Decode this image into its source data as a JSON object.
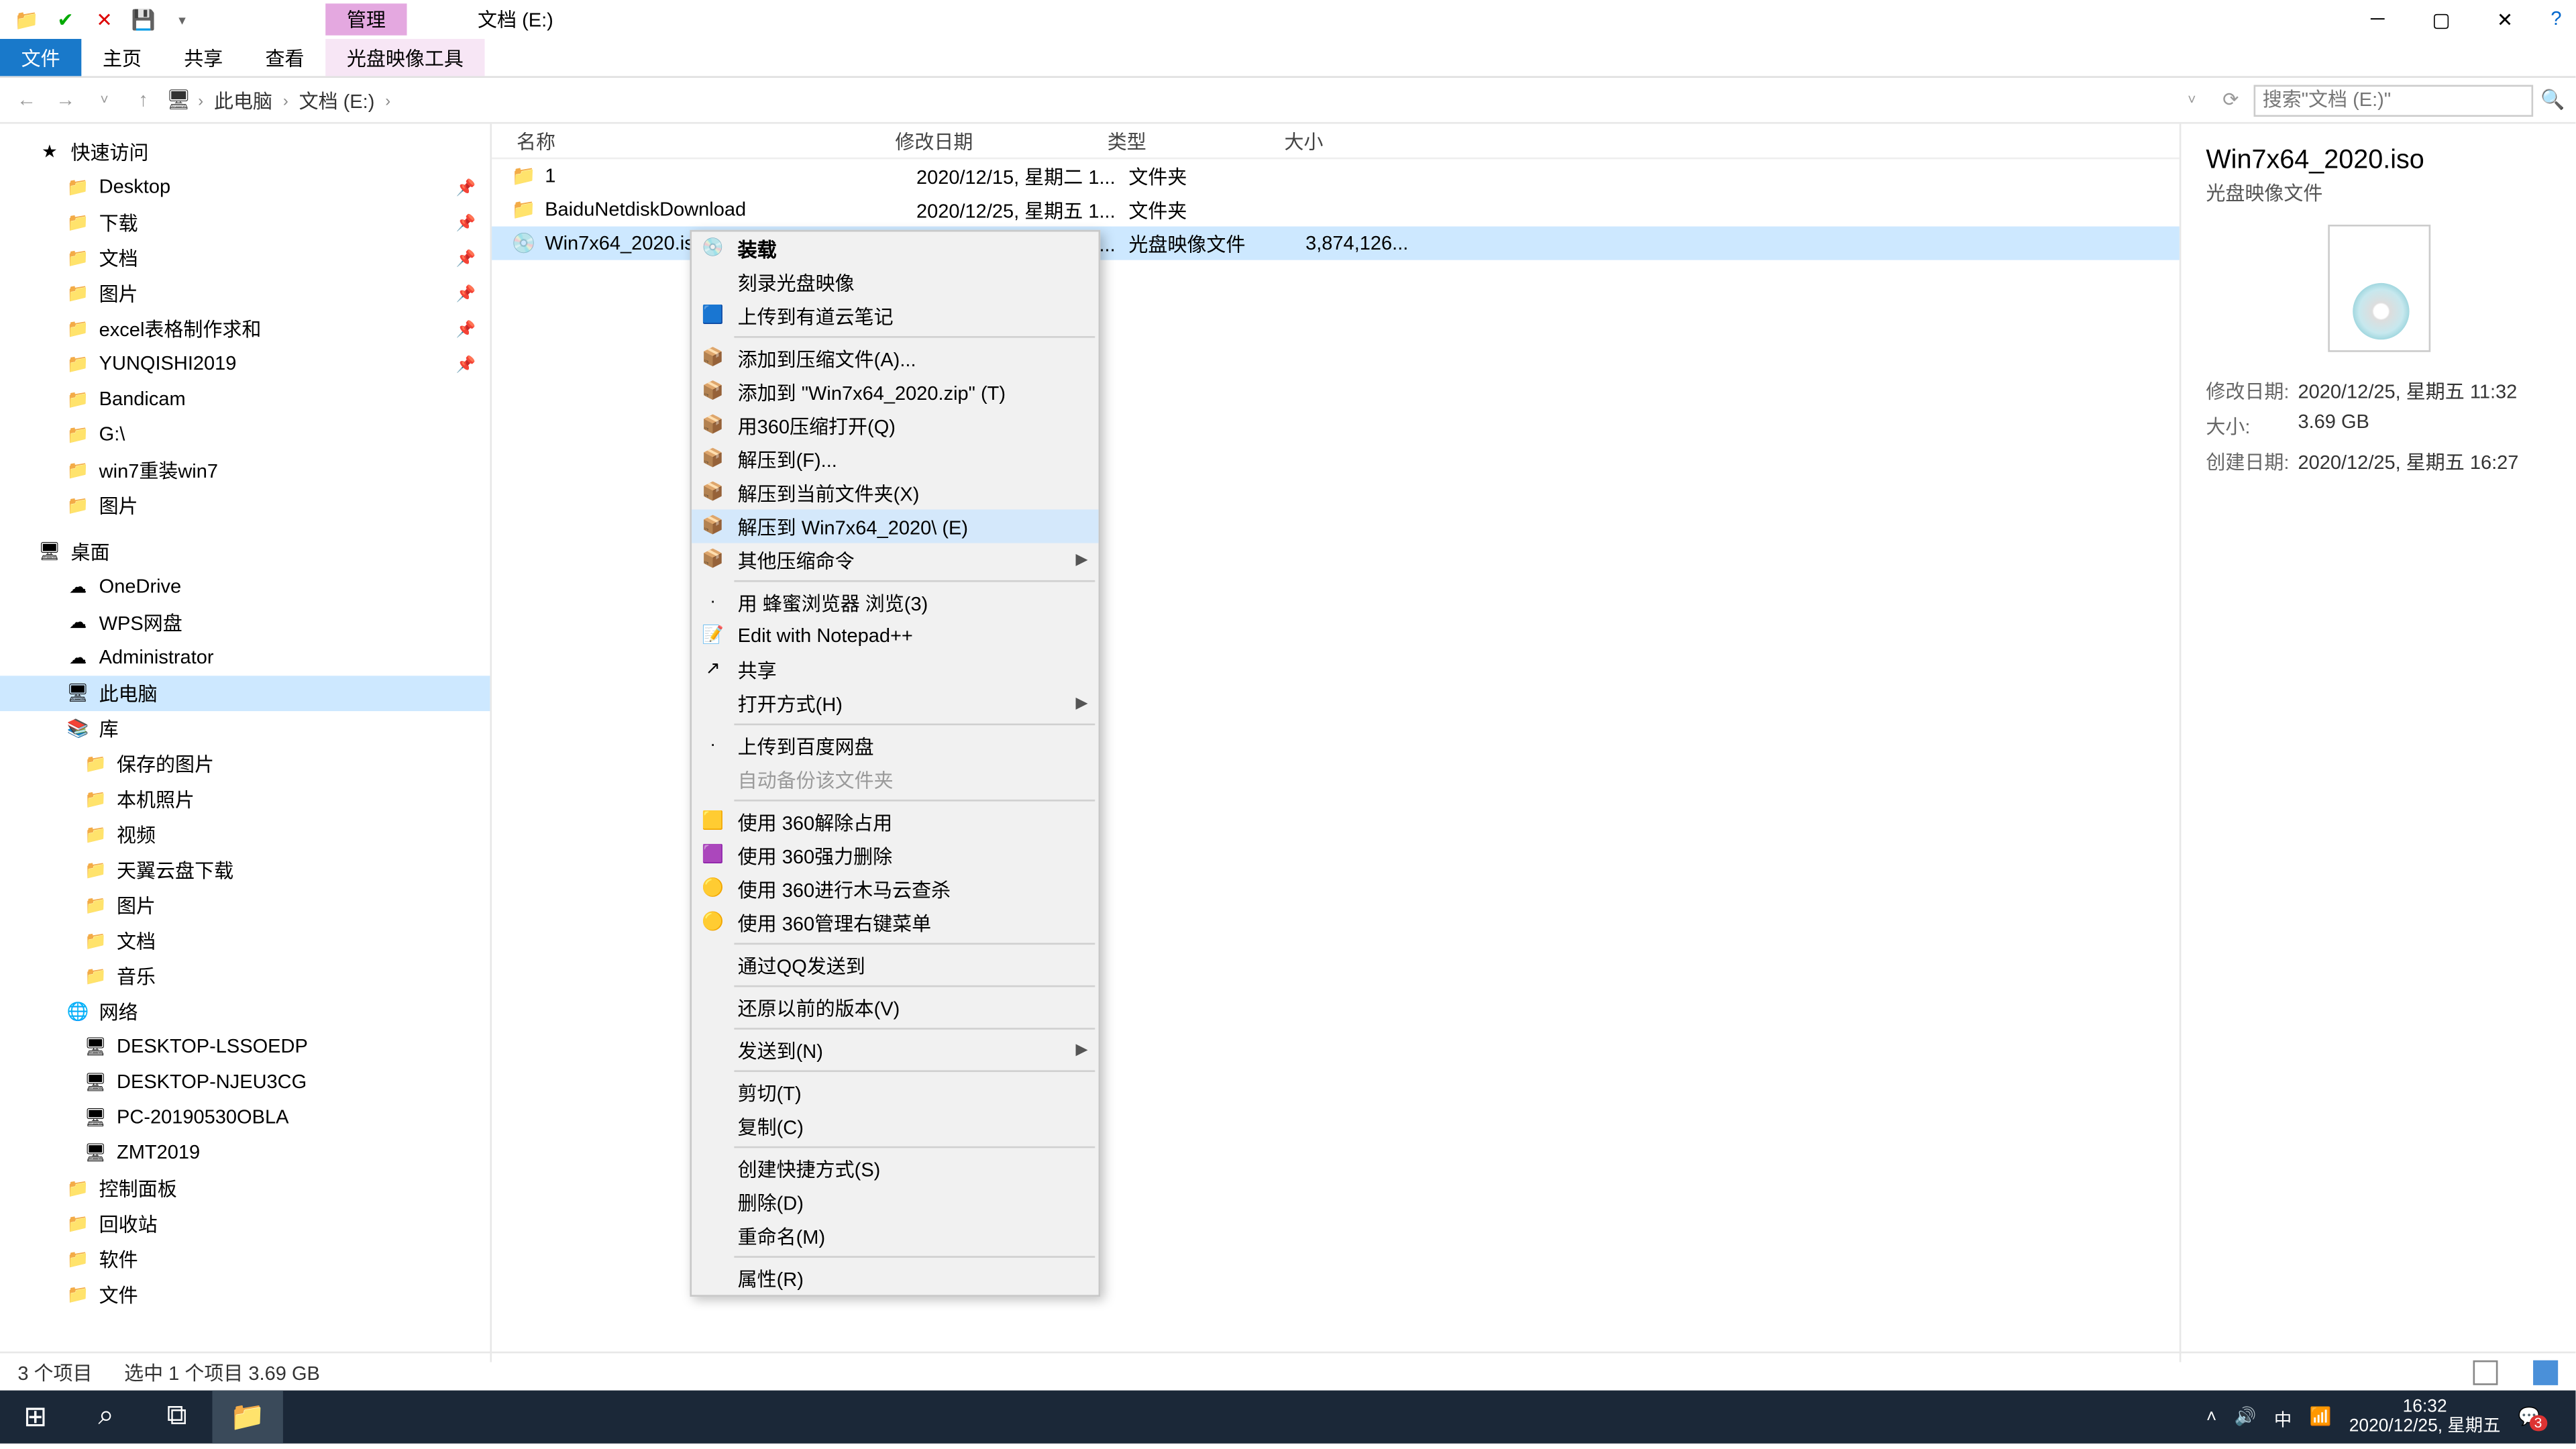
{
  "window": {
    "title": "文档 (E:)",
    "tool_tab": "管理"
  },
  "ribbon": {
    "file": "文件",
    "home": "主页",
    "share": "共享",
    "view": "查看",
    "disc": "光盘映像工具"
  },
  "address": {
    "crumbs": [
      "此电脑",
      "文档 (E:)"
    ],
    "search_placeholder": "搜索\"文档 (E:)\""
  },
  "nav": {
    "quick": "快速访问",
    "quick_items": [
      {
        "label": "Desktop",
        "pin": true
      },
      {
        "label": "下载",
        "pin": true
      },
      {
        "label": "文档",
        "pin": true
      },
      {
        "label": "图片",
        "pin": true
      },
      {
        "label": "excel表格制作求和",
        "pin": true
      },
      {
        "label": "YUNQISHI2019",
        "pin": true
      },
      {
        "label": "Bandicam"
      },
      {
        "label": "G:\\"
      },
      {
        "label": "win7重装win7"
      },
      {
        "label": "图片"
      }
    ],
    "desktop": "桌面",
    "desktop_items": [
      {
        "label": "OneDrive"
      },
      {
        "label": "WPS网盘"
      },
      {
        "label": "Administrator"
      },
      {
        "label": "此电脑",
        "sel": true
      },
      {
        "label": "库"
      }
    ],
    "lib_items": [
      {
        "label": "保存的图片"
      },
      {
        "label": "本机照片"
      },
      {
        "label": "视频"
      },
      {
        "label": "天翼云盘下载"
      },
      {
        "label": "图片"
      },
      {
        "label": "文档"
      },
      {
        "label": "音乐"
      }
    ],
    "network": "网络",
    "network_items": [
      {
        "label": "DESKTOP-LSSOEDP"
      },
      {
        "label": "DESKTOP-NJEU3CG"
      },
      {
        "label": "PC-20190530OBLA"
      },
      {
        "label": "ZMT2019"
      }
    ],
    "misc": [
      {
        "label": "控制面板"
      },
      {
        "label": "回收站"
      },
      {
        "label": "软件"
      },
      {
        "label": "文件"
      }
    ]
  },
  "columns": {
    "name": "名称",
    "modified": "修改日期",
    "type": "类型",
    "size": "大小"
  },
  "files": [
    {
      "name": "1",
      "modified": "2020/12/15, 星期二 1...",
      "type": "文件夹",
      "size": "",
      "folder": true
    },
    {
      "name": "BaiduNetdiskDownload",
      "modified": "2020/12/25, 星期五 1...",
      "type": "文件夹",
      "size": "",
      "folder": true
    },
    {
      "name": "Win7x64_2020.iso",
      "modified": "2020/12/25, 星期五 1...",
      "type": "光盘映像文件",
      "size": "3,874,126...",
      "folder": false,
      "sel": true
    }
  ],
  "context": [
    {
      "label": "装载",
      "bold": true,
      "icon": "💿"
    },
    {
      "label": "刻录光盘映像"
    },
    {
      "label": "上传到有道云笔记",
      "icon": "🟦"
    },
    {
      "sep": true
    },
    {
      "label": "添加到压缩文件(A)...",
      "icon": "📦"
    },
    {
      "label": "添加到 \"Win7x64_2020.zip\" (T)",
      "icon": "📦"
    },
    {
      "label": "用360压缩打开(Q)",
      "icon": "📦"
    },
    {
      "label": "解压到(F)...",
      "icon": "📦"
    },
    {
      "label": "解压到当前文件夹(X)",
      "icon": "📦"
    },
    {
      "label": "解压到 Win7x64_2020\\ (E)",
      "icon": "📦",
      "hover": true
    },
    {
      "label": "其他压缩命令",
      "icon": "📦",
      "sub": true
    },
    {
      "sep": true
    },
    {
      "label": "用 蜂蜜浏览器 浏览(3)",
      "icon": "·"
    },
    {
      "label": "Edit with Notepad++",
      "icon": "📝"
    },
    {
      "label": "共享",
      "icon": "↗"
    },
    {
      "label": "打开方式(H)",
      "sub": true
    },
    {
      "sep": true
    },
    {
      "label": "上传到百度网盘",
      "icon": "·"
    },
    {
      "label": "自动备份该文件夹",
      "dis": true
    },
    {
      "sep": true
    },
    {
      "label": "使用 360解除占用",
      "icon": "🟨"
    },
    {
      "label": "使用 360强力删除",
      "icon": "🟪"
    },
    {
      "label": "使用 360进行木马云查杀",
      "icon": "🟡"
    },
    {
      "label": "使用 360管理右键菜单",
      "icon": "🟡"
    },
    {
      "sep": true
    },
    {
      "label": "通过QQ发送到"
    },
    {
      "sep": true
    },
    {
      "label": "还原以前的版本(V)"
    },
    {
      "sep": true
    },
    {
      "label": "发送到(N)",
      "sub": true
    },
    {
      "sep": true
    },
    {
      "label": "剪切(T)"
    },
    {
      "label": "复制(C)"
    },
    {
      "sep": true
    },
    {
      "label": "创建快捷方式(S)"
    },
    {
      "label": "删除(D)"
    },
    {
      "label": "重命名(M)"
    },
    {
      "sep": true
    },
    {
      "label": "属性(R)"
    }
  ],
  "details": {
    "title": "Win7x64_2020.iso",
    "subtitle": "光盘映像文件",
    "meta": [
      {
        "k": "修改日期:",
        "v": "2020/12/25, 星期五 11:32"
      },
      {
        "k": "大小:",
        "v": "3.69 GB"
      },
      {
        "k": "创建日期:",
        "v": "2020/12/25, 星期五 16:27"
      }
    ]
  },
  "status": {
    "count": "3 个项目",
    "sel": "选中 1 个项目  3.69 GB"
  },
  "tray": {
    "ime": "中",
    "time": "16:32",
    "date": "2020/12/25, 星期五",
    "badge": "3"
  }
}
